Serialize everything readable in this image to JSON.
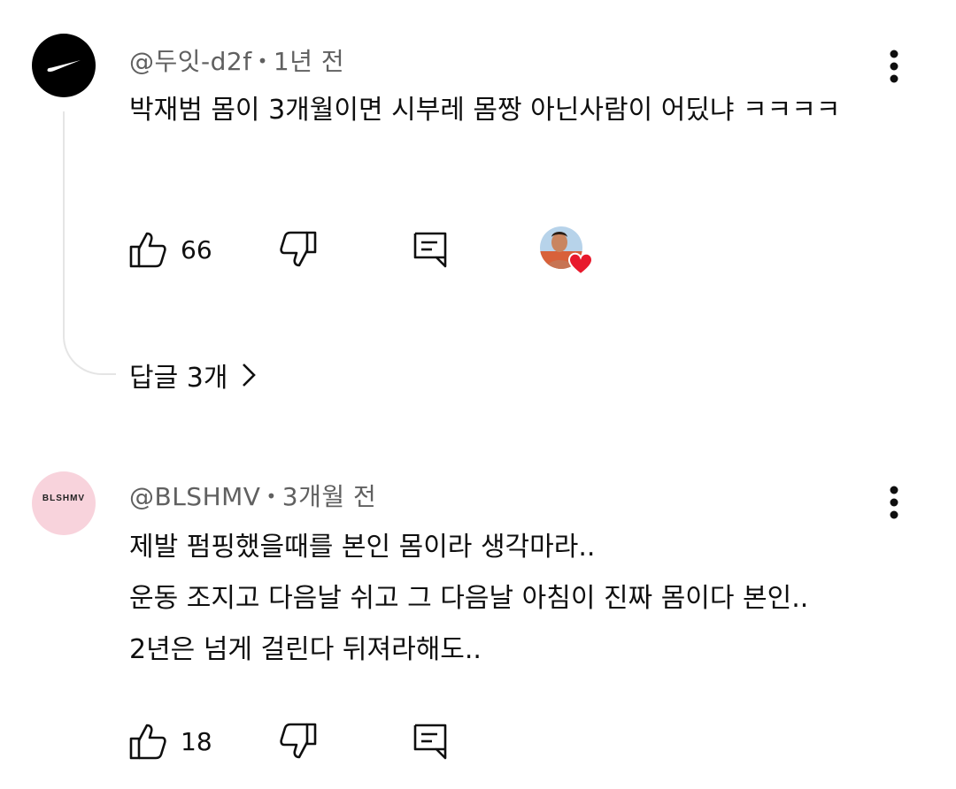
{
  "comments": [
    {
      "handle": "@두잇-d2f",
      "time": "1년 전",
      "text": "박재범 몸이 3개월이면 시부레 몸짱 아닌사람이 어딨냐 ㅋㅋㅋㅋ",
      "likes": "66",
      "replies_label": "답글 3개"
    },
    {
      "handle": "@BLSHMV",
      "avatar_text": "BLSHMV",
      "time": "3개월 전",
      "text": "제발 펌핑했을때를 본인 몸이라 생각마라..\n운동 조지고 다음날 쉬고 그 다음날 아침이 진짜 몸이다 본인..\n2년은 넘게 걸린다 뒤져라해도..",
      "likes": "18"
    }
  ],
  "separator": "•",
  "icons": [
    "nike-swoosh-icon",
    "more-vert-icon",
    "thumbs-up-icon",
    "thumbs-down-icon",
    "reply-icon",
    "creator-heart-icon",
    "chevron-right-icon"
  ],
  "colors": {
    "meta": "#606060",
    "heart": "#e8192c",
    "thread_line": "#e5e5e5",
    "bls_avatar": "#f8d3dc"
  }
}
